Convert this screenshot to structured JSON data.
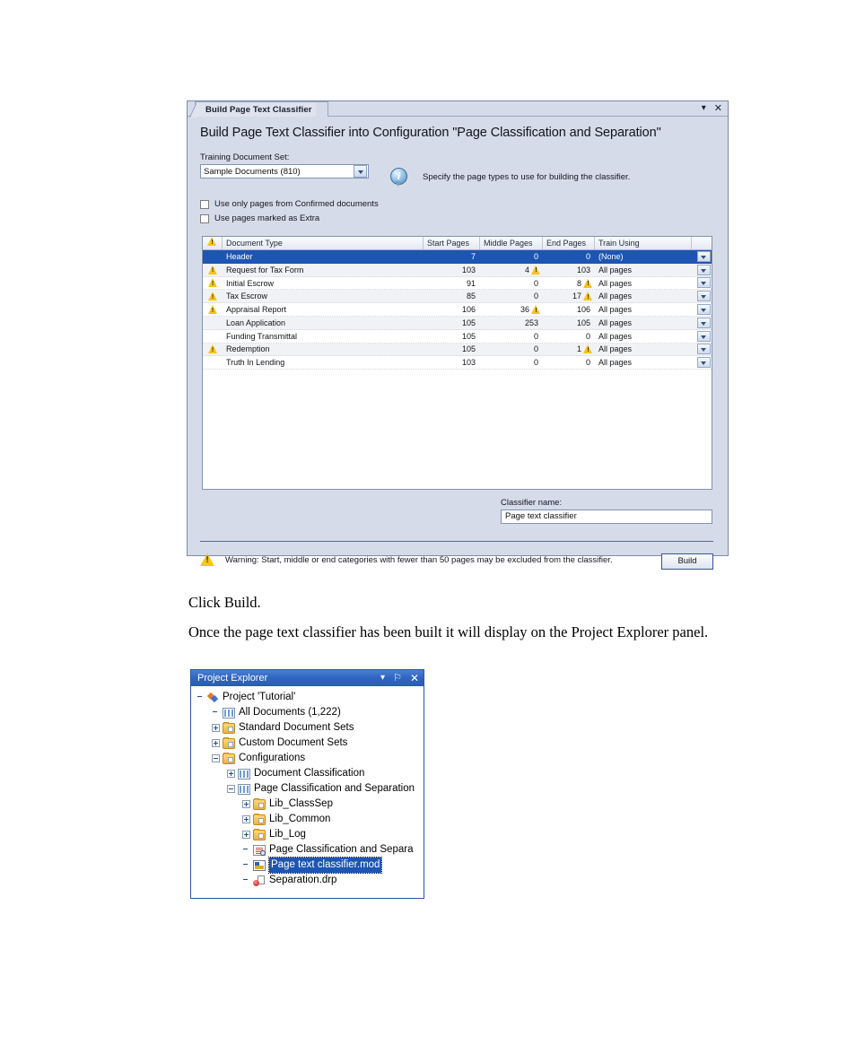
{
  "dialog": {
    "tab_label": "Build Page Text Classifier",
    "window_controls": {
      "minimize": "▾",
      "close": "✕"
    },
    "title": "Build Page Text Classifier into Configuration \"Page Classification and Separation\"",
    "training_set_label": "Training Document Set:",
    "training_set_value": "Sample Documents (810)",
    "info_icon": "i",
    "info_text": "Specify the page types to use for building the classifier.",
    "checkboxes": [
      {
        "label": "Use only pages from Confirmed documents",
        "checked": false
      },
      {
        "label": "Use pages marked as Extra",
        "checked": false
      }
    ],
    "grid": {
      "columns": [
        "",
        "Document Type",
        "Start Pages",
        "Middle Pages",
        "End Pages",
        "Train Using",
        ""
      ],
      "rows": [
        {
          "warn": false,
          "type": "Header",
          "start": "7",
          "middle": "0",
          "middle_warn": false,
          "end": "0",
          "end_warn": false,
          "train": "(None)",
          "selected": true
        },
        {
          "warn": true,
          "type": "Request for Tax Form",
          "start": "103",
          "middle": "4",
          "middle_warn": true,
          "end": "103",
          "end_warn": false,
          "train": "All pages",
          "selected": false
        },
        {
          "warn": true,
          "type": "Initial Escrow",
          "start": "91",
          "middle": "0",
          "middle_warn": false,
          "end": "8",
          "end_warn": true,
          "train": "All pages",
          "selected": false
        },
        {
          "warn": true,
          "type": "Tax Escrow",
          "start": "85",
          "middle": "0",
          "middle_warn": false,
          "end": "17",
          "end_warn": true,
          "train": "All pages",
          "selected": false
        },
        {
          "warn": true,
          "type": "Appraisal Report",
          "start": "106",
          "middle": "36",
          "middle_warn": true,
          "end": "106",
          "end_warn": false,
          "train": "All pages",
          "selected": false
        },
        {
          "warn": false,
          "type": "Loan Application",
          "start": "105",
          "middle": "253",
          "middle_warn": false,
          "end": "105",
          "end_warn": false,
          "train": "All pages",
          "selected": false
        },
        {
          "warn": false,
          "type": "Funding Transmittal",
          "start": "105",
          "middle": "0",
          "middle_warn": false,
          "end": "0",
          "end_warn": false,
          "train": "All pages",
          "selected": false
        },
        {
          "warn": true,
          "type": "Redemption",
          "start": "105",
          "middle": "0",
          "middle_warn": false,
          "end": "1",
          "end_warn": true,
          "train": "All pages",
          "selected": false
        },
        {
          "warn": false,
          "type": "Truth In Lending",
          "start": "103",
          "middle": "0",
          "middle_warn": false,
          "end": "0",
          "end_warn": false,
          "train": "All pages",
          "selected": false
        }
      ]
    },
    "classifier_name_label": "Classifier name:",
    "classifier_name_value": "Page text classifier",
    "warning_text": "Warning: Start, middle or end categories with fewer than 50 pages may be excluded from the classifier.",
    "build_button": "Build"
  },
  "prose": {
    "p1": "Click Build.",
    "p2": "Once the page text classifier has been built  it will display on the Project Explorer panel."
  },
  "project_explorer": {
    "title": "Project Explorer",
    "controls": {
      "dropdown": "▾",
      "pin": "⚐",
      "close": "✕"
    },
    "tree": [
      {
        "indent": 0,
        "expander": "none",
        "icon": "project-icon",
        "label": "Project 'Tutorial'",
        "selected": false
      },
      {
        "indent": 1,
        "expander": "none",
        "icon": "grid-icon",
        "label": "All Documents  (1,222)",
        "selected": false
      },
      {
        "indent": 1,
        "expander": "plus",
        "icon": "folder-icon",
        "label": "Standard Document Sets",
        "selected": false
      },
      {
        "indent": 1,
        "expander": "plus",
        "icon": "folder-icon",
        "label": "Custom Document Sets",
        "selected": false
      },
      {
        "indent": 1,
        "expander": "minus",
        "icon": "folder-icon",
        "label": "Configurations",
        "selected": false
      },
      {
        "indent": 2,
        "expander": "plus",
        "icon": "grid-icon",
        "label": "Document Classification",
        "selected": false
      },
      {
        "indent": 2,
        "expander": "minus",
        "icon": "grid-icon",
        "label": "Page Classification and Separation",
        "selected": false
      },
      {
        "indent": 3,
        "expander": "plus",
        "icon": "folder-icon",
        "label": "Lib_ClassSep",
        "selected": false
      },
      {
        "indent": 3,
        "expander": "plus",
        "icon": "folder-icon",
        "label": "Lib_Common",
        "selected": false
      },
      {
        "indent": 3,
        "expander": "plus",
        "icon": "folder-icon",
        "label": "Lib_Log",
        "selected": false
      },
      {
        "indent": 3,
        "expander": "none",
        "icon": "document-icon",
        "label": "Page Classification and Separa",
        "selected": false
      },
      {
        "indent": 3,
        "expander": "none",
        "icon": "module-icon",
        "label": "Page text classifier.mod",
        "selected": true
      },
      {
        "indent": 3,
        "expander": "none",
        "icon": "separation-icon",
        "label": "Separation.drp",
        "selected": false
      }
    ]
  }
}
